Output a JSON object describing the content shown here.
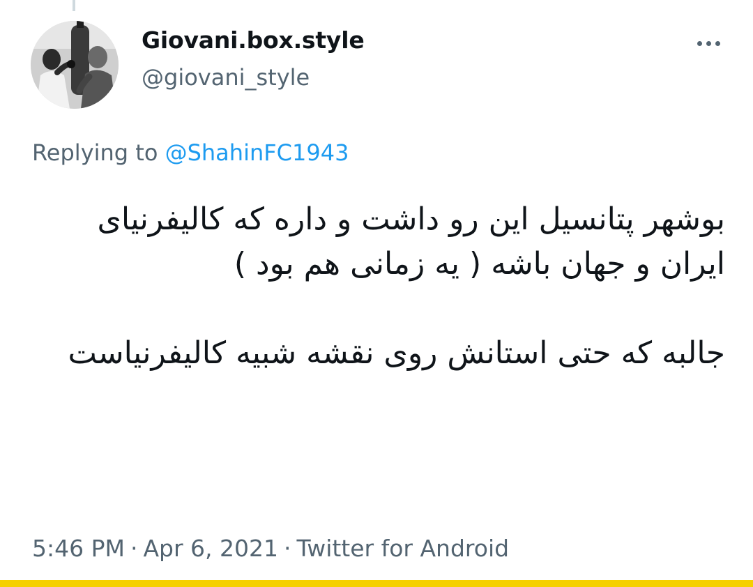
{
  "tweet": {
    "display_name": "Giovani.box.style",
    "handle": "@giovani_style",
    "replying_prefix": "Replying to ",
    "replying_to": "@ShahinFC1943",
    "text_paragraphs": [
      "بوشهر پتانسیل این رو داشت و داره که کالیفرنیای ایران و جهان باشه ( یه زمانی هم بود )",
      "جالبه که حتی استانش روی نقشه شبیه کالیفرنیاست"
    ],
    "time": "5:46 PM",
    "date": "Apr 6, 2021",
    "source": "Twitter for Android",
    "separator": "·"
  },
  "icons": {
    "more": "more-horizontal-icon",
    "avatar": "avatar-photo"
  },
  "colors": {
    "text_primary": "#0f1419",
    "text_secondary": "#536471",
    "link": "#1d9bf0",
    "thread_line": "#cfd9de",
    "bottom_bar": "#f5d000"
  }
}
